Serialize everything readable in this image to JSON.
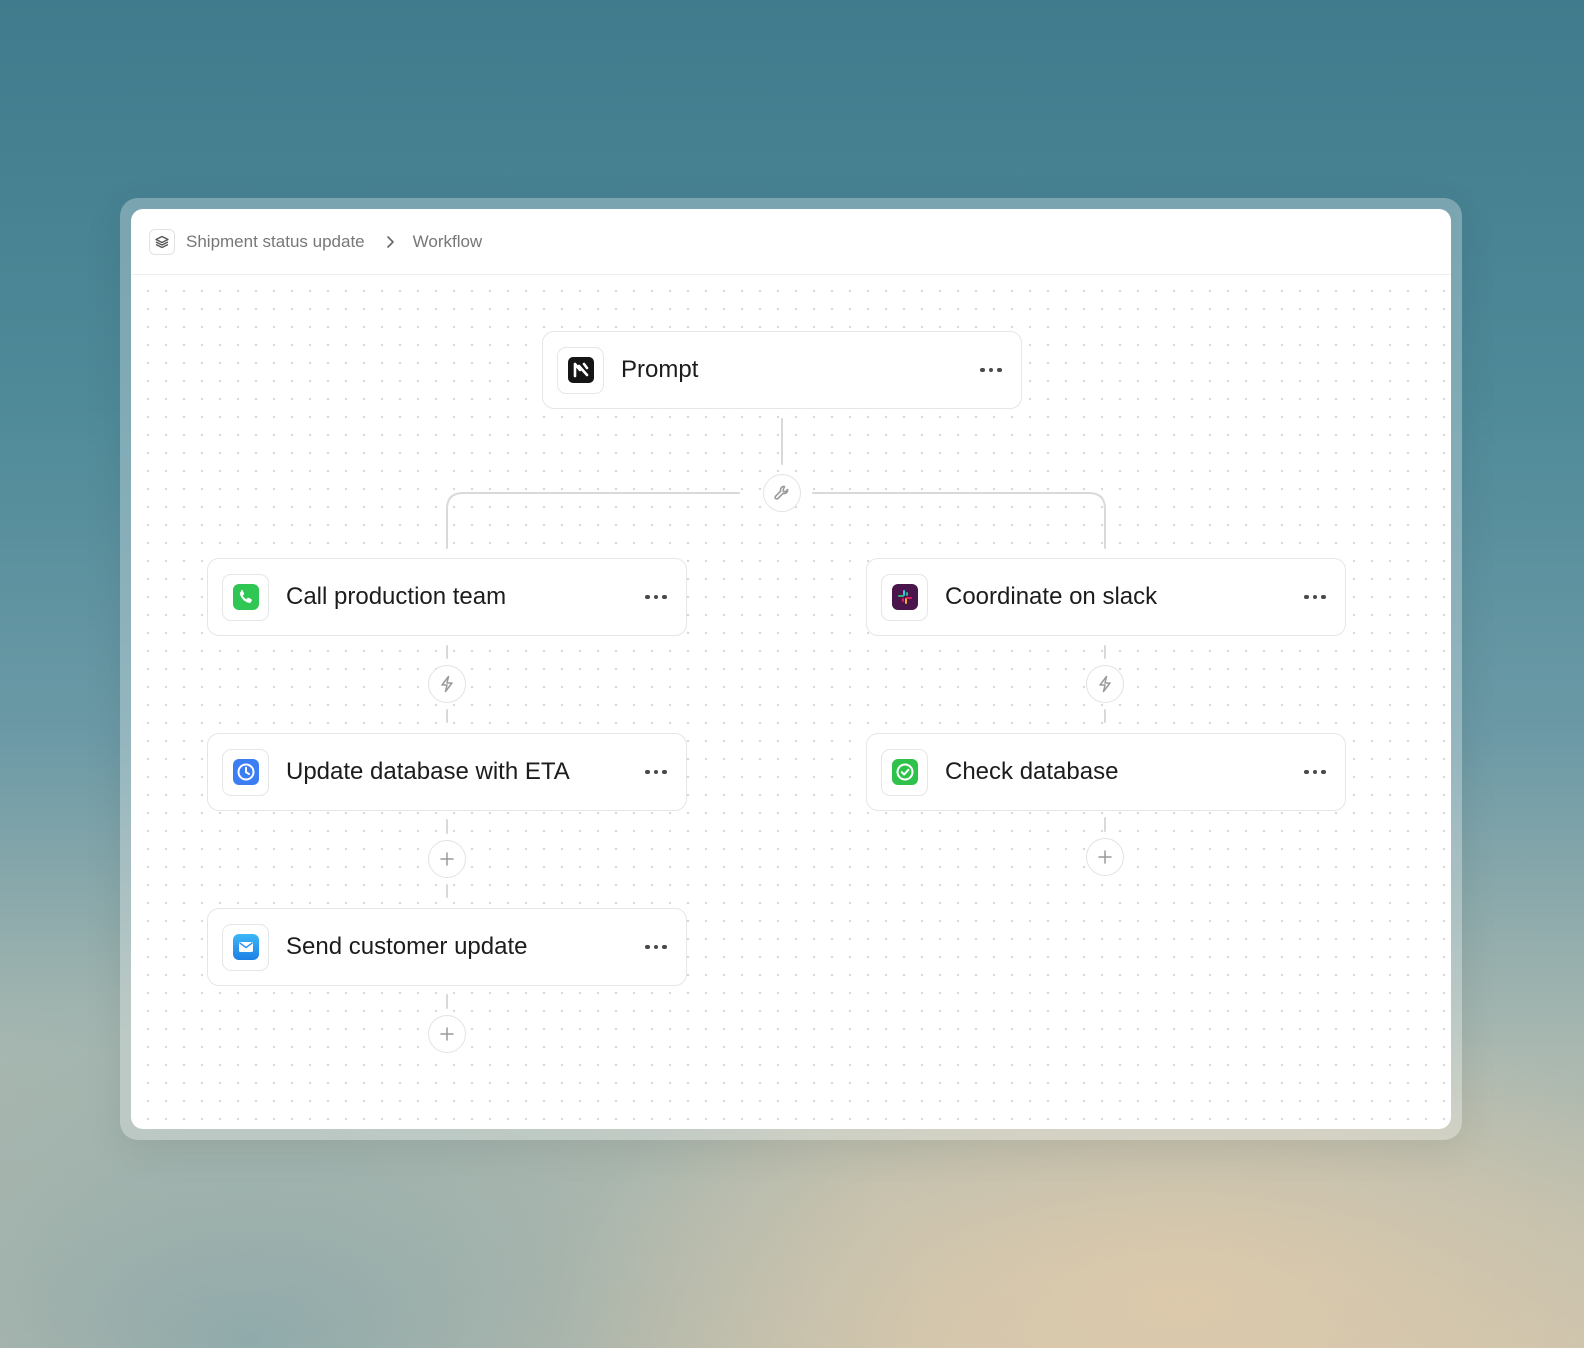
{
  "breadcrumb": {
    "app_icon": "layers-icon",
    "project": "Shipment status update",
    "separator_icon": "chevron-right-icon",
    "current": "Workflow"
  },
  "nodes": {
    "prompt": {
      "title": "Prompt",
      "icon": "app-logo-icon"
    },
    "call": {
      "title": "Call production team",
      "icon": "phone-icon",
      "color": "#34c759"
    },
    "slack": {
      "title": "Coordinate on slack",
      "icon": "slack-icon",
      "color": "#4a154b"
    },
    "update_db": {
      "title": "Update database with ETA",
      "icon": "clock-icon",
      "color": "#3b7df3"
    },
    "check_db": {
      "title": "Check database",
      "icon": "checkmark-icon",
      "color": "#2fc24a"
    },
    "send_update": {
      "title": "Send customer update",
      "icon": "mail-icon",
      "color": "#1f9bf0"
    }
  },
  "connectors": {
    "branch_icon": "wrench-icon",
    "trigger_icon": "lightning-icon",
    "add_icon": "plus-icon"
  }
}
